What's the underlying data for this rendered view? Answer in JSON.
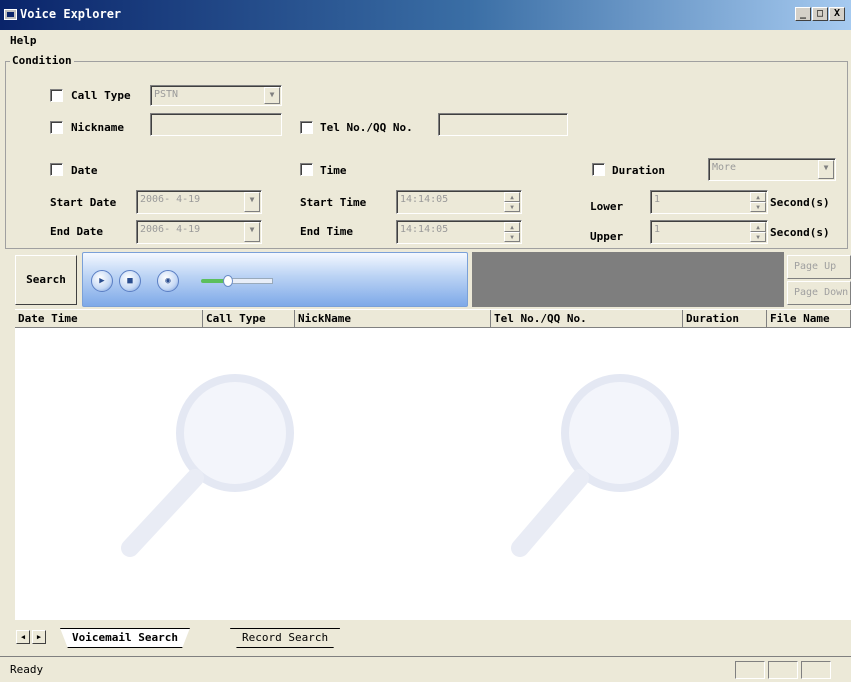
{
  "window": {
    "title": "Voice Explorer",
    "minimize": "_",
    "maximize": "□",
    "close": "X"
  },
  "menu": {
    "help": "Help"
  },
  "condition": {
    "legend": "Condition",
    "call_type": {
      "label": "Call Type",
      "value": "PSTN"
    },
    "nickname": {
      "label": "Nickname",
      "value": ""
    },
    "tel": {
      "label": "Tel No./QQ No.",
      "value": ""
    },
    "date": {
      "label": "Date"
    },
    "time": {
      "label": "Time"
    },
    "duration": {
      "label": "Duration",
      "value": "More"
    },
    "start_date": {
      "label": "Start Date",
      "value": "2006- 4-19"
    },
    "end_date": {
      "label": "End Date",
      "value": "2006- 4-19"
    },
    "start_time": {
      "label": "Start Time",
      "value": "14:14:05"
    },
    "end_time": {
      "label": "End Time",
      "value": "14:14:05"
    },
    "lower": {
      "label": "Lower",
      "value": "1",
      "unit": "Second(s)"
    },
    "upper": {
      "label": "Upper",
      "value": "1",
      "unit": "Second(s)"
    }
  },
  "toolbar": {
    "search": "Search",
    "page_up": "Page Up",
    "page_down": "Page Down"
  },
  "columns": [
    "Date Time",
    "Call Type",
    "NickName",
    "Tel No./QQ No.",
    "Duration",
    "File Name"
  ],
  "tabs": {
    "voicemail": "Voicemail Search",
    "record": "Record Search"
  },
  "status": {
    "text": "Ready"
  }
}
